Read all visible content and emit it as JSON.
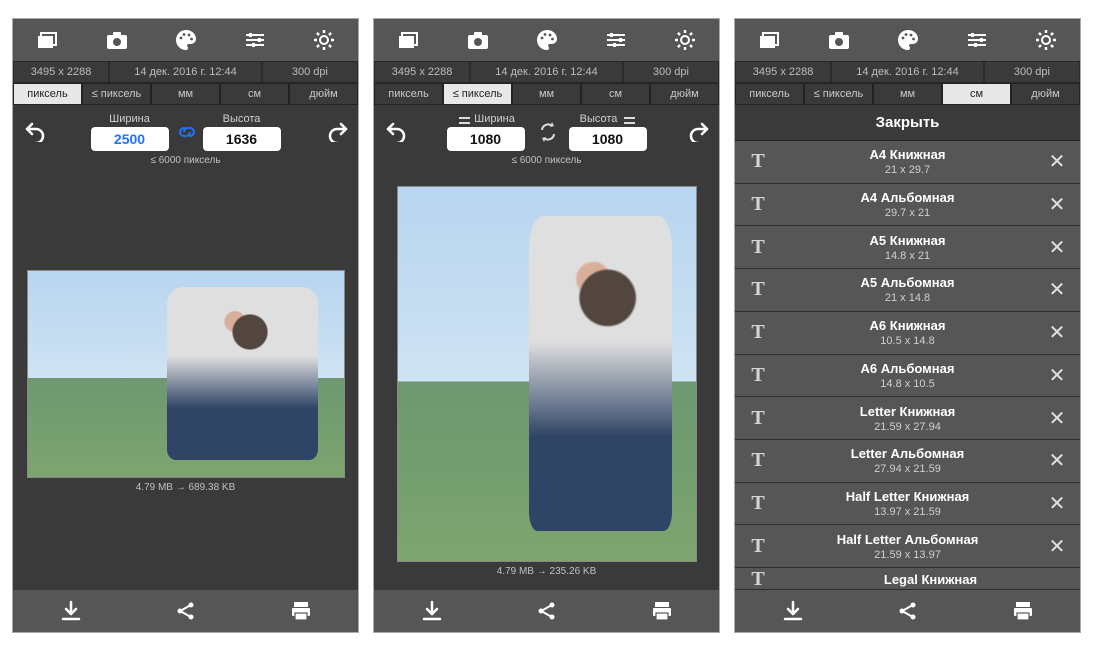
{
  "info": {
    "dims": "3495 x 2288",
    "date": "14 дек. 2016 г. 12:44",
    "dpi": "300 dpi"
  },
  "tabs": {
    "pixel": "пиксель",
    "lepixel": "≤ пиксель",
    "mm": "мм",
    "cm": "см",
    "inch": "дюйм"
  },
  "labels": {
    "width": "Ширина",
    "height": "Высота",
    "constraint": "≤ 6000 пиксель"
  },
  "screen1": {
    "width_value": "2500",
    "height_value": "1636",
    "file_before": "4.79 MB",
    "file_after": "689.38 KB"
  },
  "screen2": {
    "width_value": "1080",
    "height_value": "1080",
    "file_before": "4.79 MB",
    "file_after": "235.26 KB"
  },
  "screen3": {
    "close": "Закрыть",
    "items": [
      {
        "title": "A4 Книжная",
        "dim": "21 x 29.7"
      },
      {
        "title": "A4 Альбомная",
        "dim": "29.7 x 21"
      },
      {
        "title": "A5 Книжная",
        "dim": "14.8 x 21"
      },
      {
        "title": "A5 Альбомная",
        "dim": "21 x 14.8"
      },
      {
        "title": "A6 Книжная",
        "dim": "10.5 x 14.8"
      },
      {
        "title": "A6 Альбомная",
        "dim": "14.8 x 10.5"
      },
      {
        "title": "Letter Книжная",
        "dim": "21.59 x 27.94"
      },
      {
        "title": "Letter Альбомная",
        "dim": "27.94 x 21.59"
      },
      {
        "title": "Half Letter Книжная",
        "dim": "13.97 x 21.59"
      },
      {
        "title": "Half Letter Альбомная",
        "dim": "21.59 x 13.97"
      },
      {
        "title": "Legal Книжная",
        "dim": ""
      }
    ]
  },
  "arrow_glue": " → "
}
